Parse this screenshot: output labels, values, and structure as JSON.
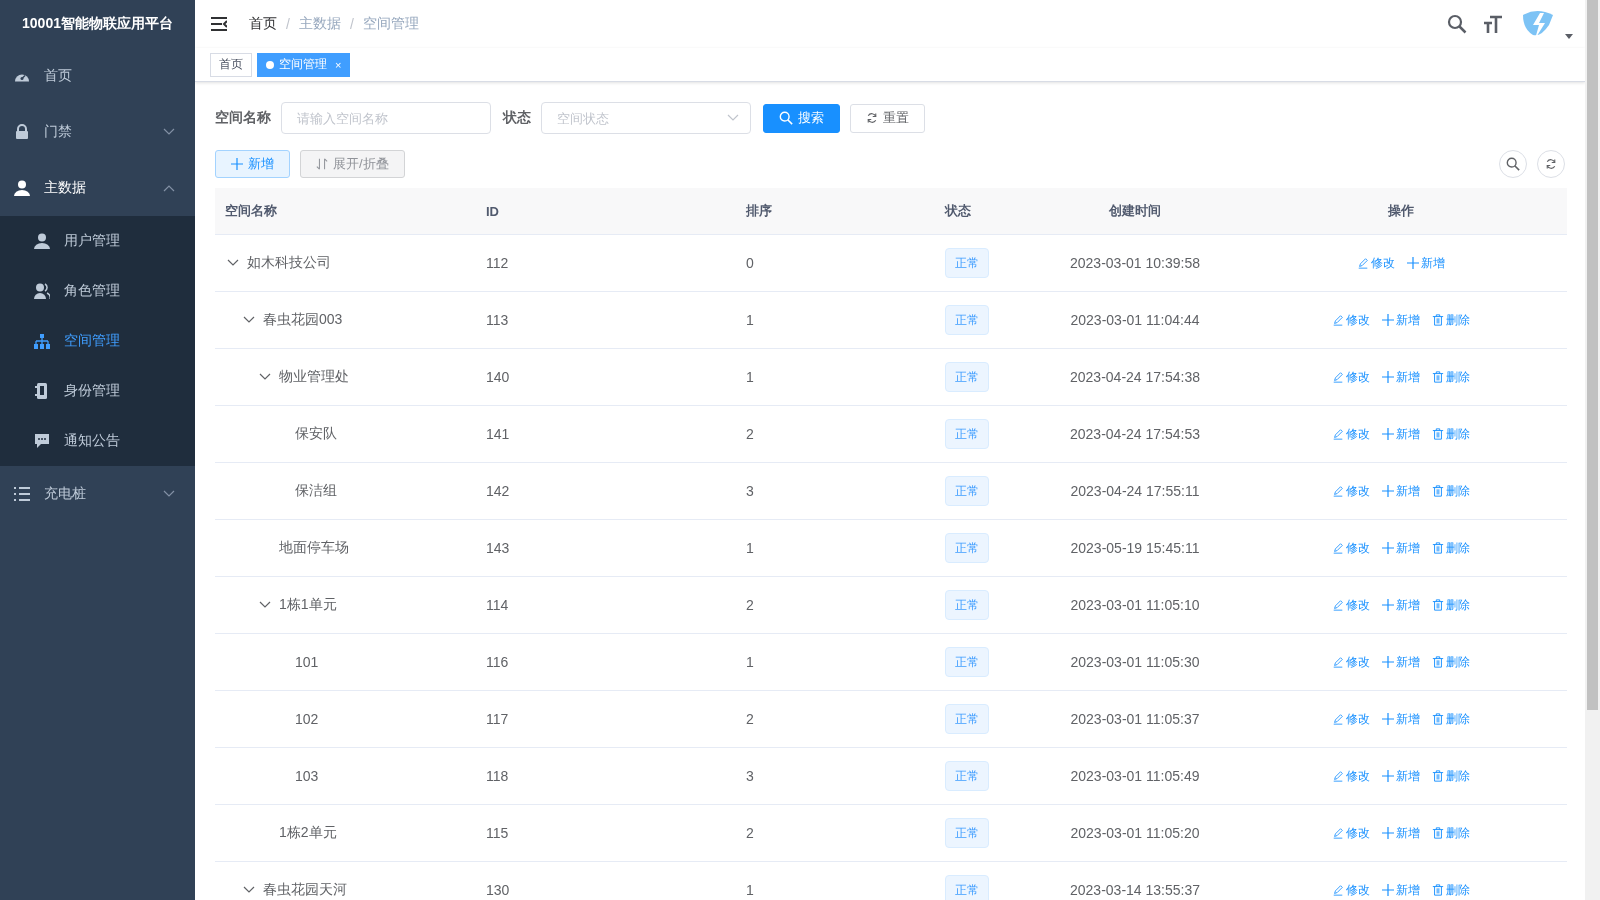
{
  "sidebar": {
    "title": "10001智能物联应用平台",
    "items": [
      {
        "label": "首页"
      },
      {
        "label": "门禁",
        "expanded": false
      },
      {
        "label": "主数据",
        "expanded": true,
        "children": [
          {
            "label": "用户管理",
            "selected": false
          },
          {
            "label": "角色管理",
            "selected": false
          },
          {
            "label": "空间管理",
            "selected": true
          },
          {
            "label": "身份管理",
            "selected": false
          },
          {
            "label": "通知公告",
            "selected": false
          }
        ]
      },
      {
        "label": "充电桩",
        "expanded": false
      }
    ]
  },
  "breadcrumb": [
    {
      "label": "首页"
    },
    {
      "separator": "/",
      "label": "主数据"
    },
    {
      "separator": "/",
      "label": "空间管理"
    }
  ],
  "tags": [
    {
      "label": "首页",
      "selected": false
    },
    {
      "label": "空间管理",
      "selected": true,
      "close": "×"
    }
  ],
  "query": {
    "fields": [
      {
        "kind": "input",
        "label": "空间名称",
        "placeholder": "请输入空间名称"
      },
      {
        "kind": "select",
        "label": "状态",
        "placeholder": "空间状态"
      }
    ],
    "buttons": [
      {
        "kind": "primary",
        "label": "搜索"
      },
      {
        "kind": "plain",
        "label": "重置"
      }
    ]
  },
  "toolbar": {
    "buttons": [
      {
        "kind": "add",
        "label": "新增"
      },
      {
        "kind": "toggle",
        "label": "展开/折叠"
      }
    ]
  },
  "table": {
    "columns": [
      "空间名称",
      "ID",
      "排序",
      "状态",
      "创建时间",
      "操作"
    ],
    "rows": [
      {
        "name": "如木科技公司",
        "id": "112",
        "sort": "0",
        "status": "正常",
        "created": "2023-03-01 10:39:58",
        "expanded": true,
        "actions": [
          {
            "kind": "edit",
            "label": "修改"
          },
          {
            "kind": "add",
            "label": "新增"
          }
        ],
        "children": [
          {
            "name": "春虫花园003",
            "id": "113",
            "sort": "1",
            "status": "正常",
            "created": "2023-03-01 11:04:44",
            "expanded": true,
            "actions": [
              {
                "kind": "edit",
                "label": "修改"
              },
              {
                "kind": "add",
                "label": "新增"
              },
              {
                "kind": "delete",
                "label": "删除"
              }
            ],
            "children": [
              {
                "name": "物业管理处",
                "id": "140",
                "sort": "1",
                "status": "正常",
                "created": "2023-04-24 17:54:38",
                "expanded": true,
                "actions": [
                  {
                    "kind": "edit",
                    "label": "修改"
                  },
                  {
                    "kind": "add",
                    "label": "新增"
                  },
                  {
                    "kind": "delete",
                    "label": "删除"
                  }
                ],
                "children": [
                  {
                    "name": "保安队",
                    "id": "141",
                    "sort": "2",
                    "status": "正常",
                    "created": "2023-04-24 17:54:53",
                    "actions": [
                      {
                        "kind": "edit",
                        "label": "修改"
                      },
                      {
                        "kind": "add",
                        "label": "新增"
                      },
                      {
                        "kind": "delete",
                        "label": "删除"
                      }
                    ]
                  },
                  {
                    "name": "保洁组",
                    "id": "142",
                    "sort": "3",
                    "status": "正常",
                    "created": "2023-04-24 17:55:11",
                    "actions": [
                      {
                        "kind": "edit",
                        "label": "修改"
                      },
                      {
                        "kind": "add",
                        "label": "新增"
                      },
                      {
                        "kind": "delete",
                        "label": "删除"
                      }
                    ]
                  }
                ]
              },
              {
                "name": "地面停车场",
                "id": "143",
                "sort": "1",
                "status": "正常",
                "created": "2023-05-19 15:45:11",
                "actions": [
                  {
                    "kind": "edit",
                    "label": "修改"
                  },
                  {
                    "kind": "add",
                    "label": "新增"
                  },
                  {
                    "kind": "delete",
                    "label": "删除"
                  }
                ]
              },
              {
                "name": "1栋1单元",
                "id": "114",
                "sort": "2",
                "status": "正常",
                "created": "2023-03-01 11:05:10",
                "expanded": true,
                "actions": [
                  {
                    "kind": "edit",
                    "label": "修改"
                  },
                  {
                    "kind": "add",
                    "label": "新增"
                  },
                  {
                    "kind": "delete",
                    "label": "删除"
                  }
                ],
                "children": [
                  {
                    "name": "101",
                    "id": "116",
                    "sort": "1",
                    "status": "正常",
                    "created": "2023-03-01 11:05:30",
                    "actions": [
                      {
                        "kind": "edit",
                        "label": "修改"
                      },
                      {
                        "kind": "add",
                        "label": "新增"
                      },
                      {
                        "kind": "delete",
                        "label": "删除"
                      }
                    ]
                  },
                  {
                    "name": "102",
                    "id": "117",
                    "sort": "2",
                    "status": "正常",
                    "created": "2023-03-01 11:05:37",
                    "actions": [
                      {
                        "kind": "edit",
                        "label": "修改"
                      },
                      {
                        "kind": "add",
                        "label": "新增"
                      },
                      {
                        "kind": "delete",
                        "label": "删除"
                      }
                    ]
                  },
                  {
                    "name": "103",
                    "id": "118",
                    "sort": "3",
                    "status": "正常",
                    "created": "2023-03-01 11:05:49",
                    "actions": [
                      {
                        "kind": "edit",
                        "label": "修改"
                      },
                      {
                        "kind": "add",
                        "label": "新增"
                      },
                      {
                        "kind": "delete",
                        "label": "删除"
                      }
                    ]
                  }
                ]
              },
              {
                "name": "1栋2单元",
                "id": "115",
                "sort": "2",
                "status": "正常",
                "created": "2023-03-01 11:05:20",
                "actions": [
                  {
                    "kind": "edit",
                    "label": "修改"
                  },
                  {
                    "kind": "add",
                    "label": "新增"
                  },
                  {
                    "kind": "delete",
                    "label": "删除"
                  }
                ]
              }
            ]
          },
          {
            "name": "春虫花园天河",
            "id": "130",
            "sort": "1",
            "status": "正常",
            "created": "2023-03-14 13:55:37",
            "expanded": true,
            "actions": [
              {
                "kind": "edit",
                "label": "修改"
              },
              {
                "kind": "add",
                "label": "新增"
              },
              {
                "kind": "delete",
                "label": "删除"
              }
            ]
          }
        ]
      }
    ]
  }
}
